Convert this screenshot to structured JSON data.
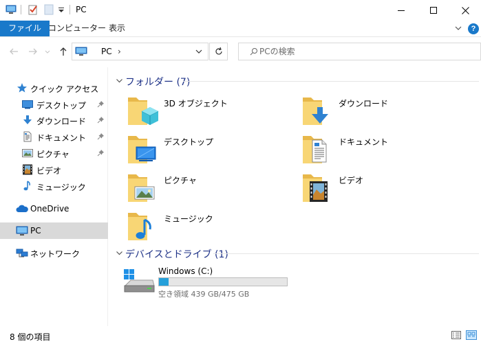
{
  "window": {
    "title": "PC"
  },
  "ribbon": {
    "tabs": [
      {
        "label": "ファイル"
      },
      {
        "label": "コンピューター"
      },
      {
        "label": "表示"
      }
    ],
    "help_label": "?"
  },
  "address": {
    "path": "PC",
    "separator": "›",
    "search_placeholder": "PCの検索"
  },
  "sidebar": {
    "quick_access": "クイック アクセス",
    "pinned": [
      {
        "label": "デスクトップ",
        "icon": "desktop-icon"
      },
      {
        "label": "ダウンロード",
        "icon": "download-icon"
      },
      {
        "label": "ドキュメント",
        "icon": "document-icon"
      },
      {
        "label": "ピクチャ",
        "icon": "pictures-icon"
      }
    ],
    "recent": [
      {
        "label": "ビデオ",
        "icon": "video-icon"
      },
      {
        "label": "ミュージック",
        "icon": "music-icon"
      }
    ],
    "onedrive": "OneDrive",
    "pc": "PC",
    "network": "ネットワーク"
  },
  "main": {
    "folders_header": "フォルダー (7)",
    "folders": [
      {
        "label": "3D オブジェクト",
        "icon": "3d-objects-folder-icon"
      },
      {
        "label": "ダウンロード",
        "icon": "downloads-folder-icon"
      },
      {
        "label": "デスクトップ",
        "icon": "desktop-folder-icon"
      },
      {
        "label": "ドキュメント",
        "icon": "documents-folder-icon"
      },
      {
        "label": "ピクチャ",
        "icon": "pictures-folder-icon"
      },
      {
        "label": "ビデオ",
        "icon": "videos-folder-icon"
      },
      {
        "label": "ミュージック",
        "icon": "music-folder-icon"
      }
    ],
    "devices_header": "デバイスとドライブ (1)",
    "drive": {
      "name": "Windows (C:)",
      "free_text": "空き領域 439 GB/475 GB",
      "used_fraction": 0.076
    }
  },
  "status": {
    "item_count": "8 個の項目"
  },
  "colors": {
    "accent": "#1979ca",
    "header_text": "#1e3287",
    "selection": "#d9d9d9",
    "drive_bar": "#26a0da"
  }
}
